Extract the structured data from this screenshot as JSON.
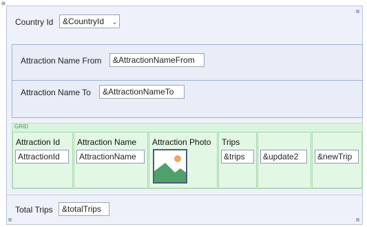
{
  "country": {
    "label": "Country Id",
    "value": "&CountryId",
    "dropdown_icon": "chevron-down-icon"
  },
  "attraction_from": {
    "label": "Attraction Name From",
    "value": "&AttractionNameFrom"
  },
  "attraction_to": {
    "label": "Attraction Name To",
    "value": "&AttractionNameTo"
  },
  "grid": {
    "tag": "GRID",
    "columns": [
      {
        "header": "Attraction Id",
        "value": "AttractionId"
      },
      {
        "header": "Attraction Name",
        "value": "AttractionName"
      },
      {
        "header": "Attraction Photo",
        "value": ""
      },
      {
        "header": "Trips",
        "value": "&trips"
      },
      {
        "header": "",
        "value": "&update2"
      },
      {
        "header": "",
        "value": "&newTrip"
      }
    ],
    "photo_icon": "image-placeholder-icon"
  },
  "total_trips": {
    "label": "Total Trips",
    "value": "&totalTrips"
  },
  "colors": {
    "panel": "#eef1f9",
    "grid": "#d9f3dc",
    "border": "#9fb0d6"
  }
}
